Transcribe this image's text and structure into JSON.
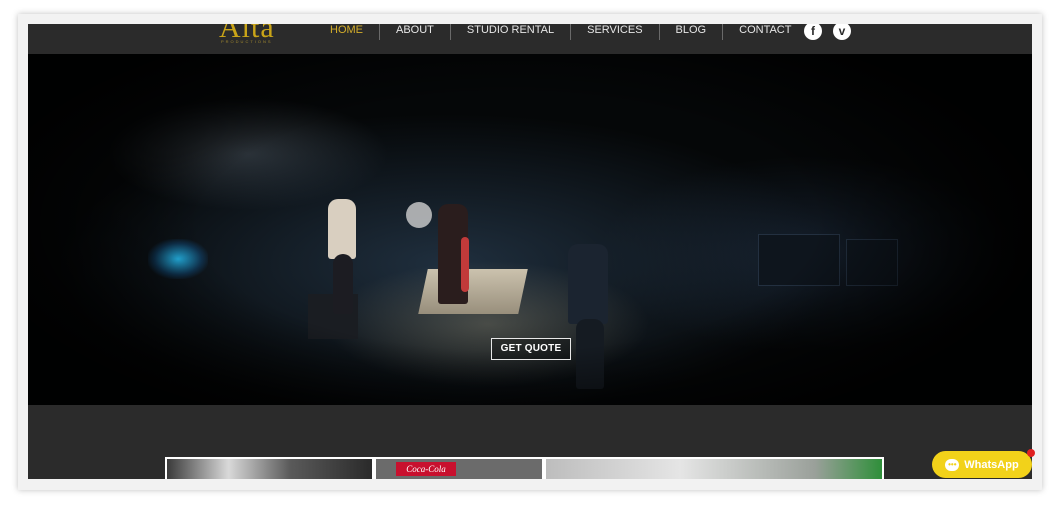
{
  "brand": {
    "logo_text": "Alta",
    "logo_subtitle": "PRODUCTIONS"
  },
  "nav": {
    "items": [
      {
        "label": "HOME",
        "active": true
      },
      {
        "label": "ABOUT",
        "active": false
      },
      {
        "label": "STUDIO RENTAL",
        "active": false
      },
      {
        "label": "SERVICES",
        "active": false
      },
      {
        "label": "BLOG",
        "active": false
      },
      {
        "label": "CONTACT",
        "active": false
      }
    ]
  },
  "social": {
    "facebook_glyph": "f",
    "vimeo_glyph": "v"
  },
  "hero": {
    "cta_label": "GET QUOTE"
  },
  "gallery": {
    "sign_text": "Coca-Cola"
  },
  "whatsapp": {
    "label": "WhatsApp",
    "icon": "chat-bubble-icon"
  },
  "colors": {
    "accent": "#d4ae2a",
    "header_bg": "#2b2b2b",
    "whatsapp_bg": "#f2d21a"
  }
}
